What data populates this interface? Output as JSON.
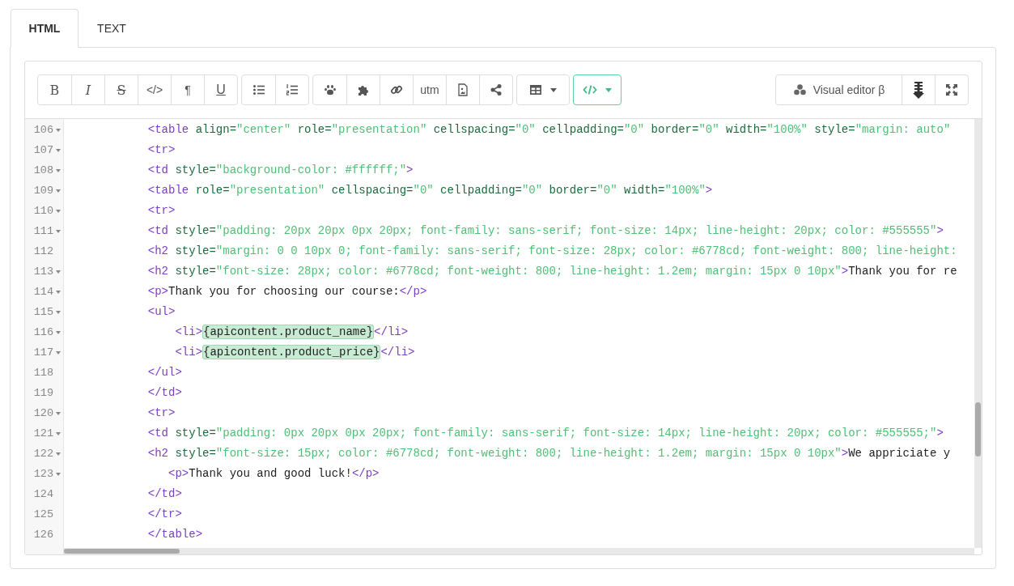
{
  "tabs": [
    {
      "label": "HTML",
      "selected": true
    },
    {
      "label": "TEXT",
      "selected": false
    }
  ],
  "toolbar": {
    "groups": [
      {
        "items": [
          {
            "kind": "label",
            "label": "B"
          },
          {
            "kind": "label",
            "label": "I"
          },
          {
            "kind": "label",
            "label": "S"
          },
          {
            "kind": "label",
            "label": "</>"
          },
          {
            "kind": "label",
            "label": "¶"
          },
          {
            "kind": "label",
            "label": "U"
          }
        ]
      },
      {
        "items": [
          {
            "kind": "icon"
          },
          {
            "kind": "icon"
          }
        ]
      },
      {
        "items": [
          {
            "kind": "icon"
          },
          {
            "kind": "icon"
          },
          {
            "kind": "icon"
          },
          {
            "kind": "label",
            "label": "utm"
          },
          {
            "kind": "icon"
          },
          {
            "kind": "icon"
          }
        ]
      },
      {
        "items": [
          {
            "kind": "dropdown",
            "selected": false
          }
        ]
      },
      {
        "items": [
          {
            "kind": "dropdown",
            "selected": true
          }
        ]
      }
    ],
    "right": [
      {
        "kind": "button",
        "label": "Visual editor β"
      },
      {
        "kind": "icon"
      },
      {
        "kind": "icon"
      }
    ]
  },
  "code_lines": [
    {
      "number": "106",
      "foldable": true,
      "tokens": [
        {
          "kind": "tag",
          "text": "            <table"
        },
        {
          "kind": "attr",
          "text": " align="
        },
        {
          "kind": "str",
          "text": "\"center\""
        },
        {
          "kind": "attr",
          "text": " role="
        },
        {
          "kind": "str",
          "text": "\"presentation\""
        },
        {
          "kind": "attr",
          "text": " cellspacing="
        },
        {
          "kind": "str",
          "text": "\"0\""
        },
        {
          "kind": "attr",
          "text": " cellpadding="
        },
        {
          "kind": "str",
          "text": "\"0\""
        },
        {
          "kind": "attr",
          "text": " border="
        },
        {
          "kind": "str",
          "text": "\"0\""
        },
        {
          "kind": "attr",
          "text": " width="
        },
        {
          "kind": "str",
          "text": "\"100%\""
        },
        {
          "kind": "attr",
          "text": " style="
        },
        {
          "kind": "str",
          "text": "\"margin: auto\""
        }
      ]
    },
    {
      "number": "107",
      "foldable": true,
      "tokens": [
        {
          "kind": "tag",
          "text": "            <tr>"
        }
      ]
    },
    {
      "number": "108",
      "foldable": true,
      "tokens": [
        {
          "kind": "tag",
          "text": "            <td"
        },
        {
          "kind": "attr",
          "text": " style="
        },
        {
          "kind": "str",
          "text": "\"background-color: #ffffff;\""
        },
        {
          "kind": "tag",
          "text": ">"
        }
      ]
    },
    {
      "number": "109",
      "foldable": true,
      "tokens": [
        {
          "kind": "tag",
          "text": "            <table"
        },
        {
          "kind": "attr",
          "text": " role="
        },
        {
          "kind": "str",
          "text": "\"presentation\""
        },
        {
          "kind": "attr",
          "text": " cellspacing="
        },
        {
          "kind": "str",
          "text": "\"0\""
        },
        {
          "kind": "attr",
          "text": " cellpadding="
        },
        {
          "kind": "str",
          "text": "\"0\""
        },
        {
          "kind": "attr",
          "text": " border="
        },
        {
          "kind": "str",
          "text": "\"0\""
        },
        {
          "kind": "attr",
          "text": " width="
        },
        {
          "kind": "str",
          "text": "\"100%\""
        },
        {
          "kind": "tag",
          "text": ">"
        }
      ]
    },
    {
      "number": "110",
      "foldable": true,
      "tokens": [
        {
          "kind": "tag",
          "text": "            <tr>"
        }
      ]
    },
    {
      "number": "111",
      "foldable": true,
      "tokens": [
        {
          "kind": "tag",
          "text": "            <td"
        },
        {
          "kind": "attr",
          "text": " style="
        },
        {
          "kind": "str",
          "text": "\"padding: 20px 20px 0px 20px; font-family: sans-serif; font-size: 14px; line-height: 20px; color: #555555\""
        },
        {
          "kind": "tag",
          "text": ">"
        }
      ]
    },
    {
      "number": "112",
      "foldable": false,
      "tokens": [
        {
          "kind": "tag",
          "text": "            <h2"
        },
        {
          "kind": "attr",
          "text": " style="
        },
        {
          "kind": "str",
          "text": "\"margin: 0 0 10px 0; font-family: sans-serif; font-size: 28px; color: #6778cd; font-weight: 800; line-height:"
        }
      ]
    },
    {
      "number": "113",
      "foldable": true,
      "tokens": [
        {
          "kind": "tag",
          "text": "            <h2"
        },
        {
          "kind": "attr",
          "text": " style="
        },
        {
          "kind": "str",
          "text": "\"font-size: 28px; color: #6778cd; font-weight: 800; line-height: 1.2em; margin: 15px 0 10px\""
        },
        {
          "kind": "tag",
          "text": ">"
        },
        {
          "kind": "text",
          "text": "Thank you for re"
        }
      ]
    },
    {
      "number": "114",
      "foldable": true,
      "tokens": [
        {
          "kind": "tag",
          "text": "            <p>"
        },
        {
          "kind": "text",
          "text": "Thank you for choosing our course:"
        },
        {
          "kind": "tag",
          "text": "</p>"
        }
      ]
    },
    {
      "number": "115",
      "foldable": true,
      "tokens": [
        {
          "kind": "tag",
          "text": "            <ul>"
        }
      ]
    },
    {
      "number": "116",
      "foldable": true,
      "tokens": [
        {
          "kind": "tag",
          "text": "                <li>"
        },
        {
          "kind": "var",
          "text": "{apicontent.product_name}"
        },
        {
          "kind": "tag",
          "text": "</li>"
        }
      ]
    },
    {
      "number": "117",
      "foldable": true,
      "tokens": [
        {
          "kind": "tag",
          "text": "                <li>"
        },
        {
          "kind": "var",
          "text": "{apicontent.product_price}"
        },
        {
          "kind": "tag",
          "text": "</li>"
        }
      ]
    },
    {
      "number": "118",
      "foldable": false,
      "tokens": [
        {
          "kind": "tag",
          "text": "            </ul>"
        }
      ]
    },
    {
      "number": "119",
      "foldable": false,
      "tokens": [
        {
          "kind": "tag",
          "text": "            </td>"
        }
      ]
    },
    {
      "number": "120",
      "foldable": true,
      "tokens": [
        {
          "kind": "tag",
          "text": "            <tr>"
        }
      ]
    },
    {
      "number": "121",
      "foldable": true,
      "tokens": [
        {
          "kind": "tag",
          "text": "            <td"
        },
        {
          "kind": "attr",
          "text": " style="
        },
        {
          "kind": "str",
          "text": "\"padding: 0px 20px 0px 20px; font-family: sans-serif; font-size: 14px; line-height: 20px; color: #555555;\""
        },
        {
          "kind": "tag",
          "text": ">"
        }
      ]
    },
    {
      "number": "122",
      "foldable": true,
      "tokens": [
        {
          "kind": "tag",
          "text": "            <h2"
        },
        {
          "kind": "attr",
          "text": " style="
        },
        {
          "kind": "str",
          "text": "\"font-size: 15px; color: #6778cd; font-weight: 800; line-height: 1.2em; margin: 15px 0 10px\""
        },
        {
          "kind": "tag",
          "text": ">"
        },
        {
          "kind": "text",
          "text": "We appriciate y"
        }
      ]
    },
    {
      "number": "123",
      "foldable": true,
      "tokens": [
        {
          "kind": "tag",
          "text": "               <p>"
        },
        {
          "kind": "text",
          "text": "Thank you and good luck!"
        },
        {
          "kind": "tag",
          "text": "</p>"
        }
      ]
    },
    {
      "number": "124",
      "foldable": false,
      "tokens": [
        {
          "kind": "tag",
          "text": "            </td>"
        }
      ]
    },
    {
      "number": "125",
      "foldable": false,
      "tokens": [
        {
          "kind": "tag",
          "text": "            </tr>"
        }
      ]
    },
    {
      "number": "126",
      "foldable": false,
      "tokens": [
        {
          "kind": "tag",
          "text": "            </table>"
        }
      ]
    }
  ]
}
